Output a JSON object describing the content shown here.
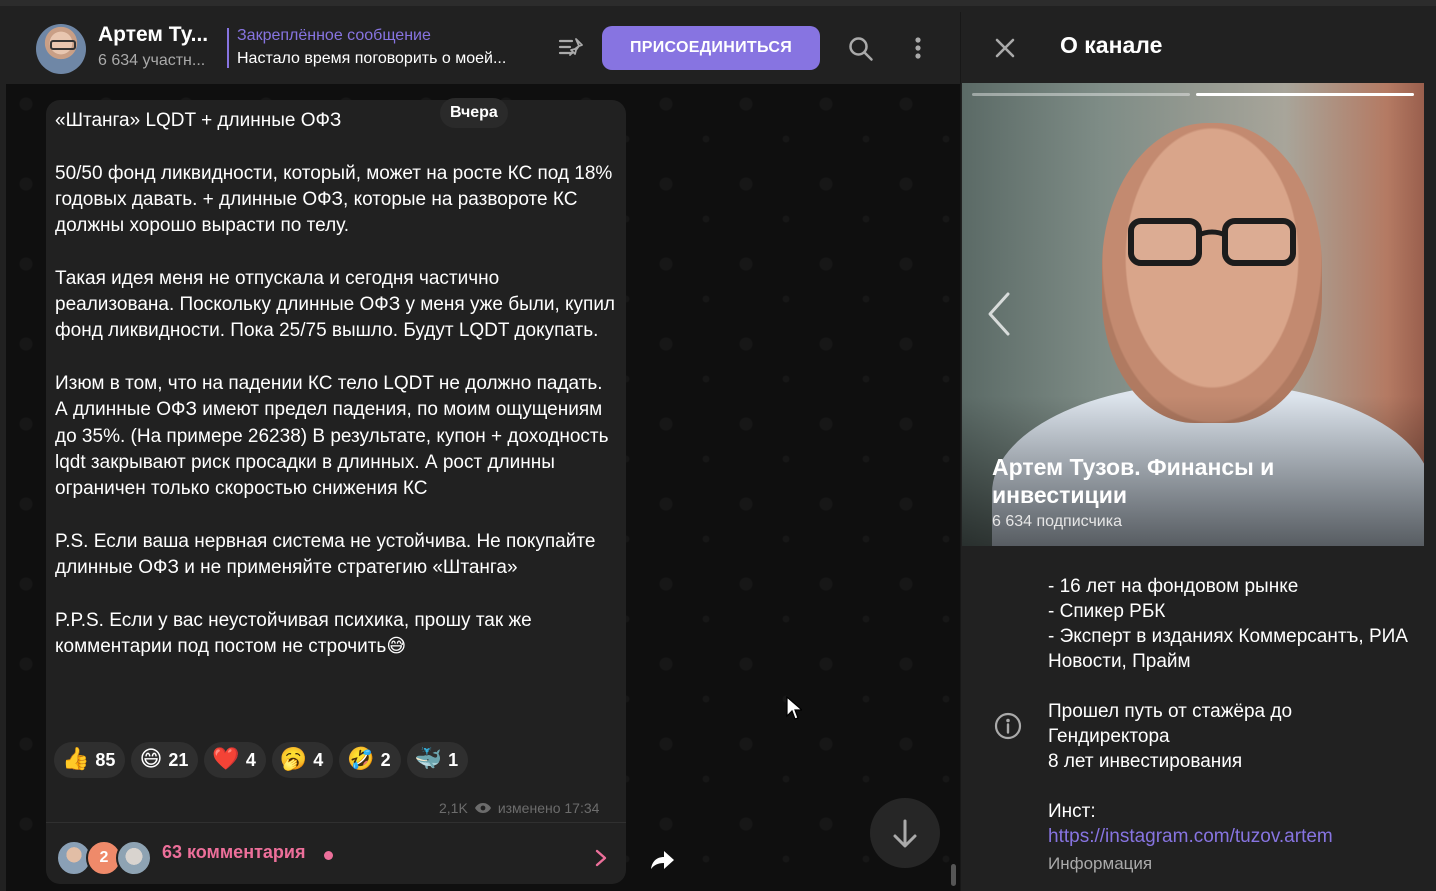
{
  "chat_header": {
    "title": "Артем Ту...",
    "subtitle": "6 634 участн...",
    "pinned_title": "Закреплённое сообщение",
    "pinned_text": "Настало время поговорить о моей...",
    "join_label": "ПРИСОЕДИНИТЬСЯ"
  },
  "message": {
    "date": "Вчера",
    "text": "«Штанга» LQDT + длинные ОФЗ\n\n50/50 фонд ликвидности, который, может на росте КС под 18% годовых давать. + длинные ОФЗ, которые на развороте КС должны хорошо вырасти по телу.\n\nТакая идея меня не отпускала и сегодня частично реализована. Поскольку длинные ОФЗ у меня уже были, купил фонд ликвидности. Пока 25/75 вышло. Будут LQDT докупать.\n\nИзюм в том, что на падении КС тело LQDT не должно падать. А длинные ОФЗ имеют предел падения, по моим ощущениям до 35%. (На примере 26238) В результате, купон + доходность lqdt закрывают риск просадки в длинных. А рост длинны ограничен только скоростью снижения КС\n\nP.S. Если ваша нервная система не устойчива. Не покупайте длинные ОФЗ и не применяйте стратегию «Штанга»\n\nP.P.S. Если у вас неустойчивая психика, прошу так же комментарии под постом не строчить😅",
    "reactions": [
      {
        "emoji": "👍",
        "count": "85"
      },
      {
        "emoji": "😄",
        "count": "21"
      },
      {
        "emoji": "❤️",
        "count": "4"
      },
      {
        "emoji": "🥱",
        "count": "4"
      },
      {
        "emoji": "🤣",
        "count": "2"
      },
      {
        "emoji": "🐳",
        "count": "1"
      }
    ],
    "views": "2,1K",
    "edited": "изменено 17:34",
    "comments_label": "63 комментария",
    "commenter_badge": "2"
  },
  "info_panel": {
    "title": "О канале",
    "channel_name": "Артем Тузов. Финансы и инвестиции",
    "subscribers": "6 634 подписчика",
    "bio_top": "- 16 лет на фондовом рынке\n- Спикер РБК\n- Эксперт в изданиях Коммерсантъ, РИА Новости, Прайм",
    "bio_mid": "Прошел путь от стажёра до Гендиректора\n8 лет инвестирования",
    "bio_inst_label": "Инст:",
    "bio_link": "https://instagram.com/tuzov.artem",
    "bio_footer": "Информация"
  },
  "colors": {
    "accent": "#8774e1",
    "comments": "#ec6f9a",
    "panel_bg": "#212121",
    "chat_bg": "#0f0f0f"
  }
}
